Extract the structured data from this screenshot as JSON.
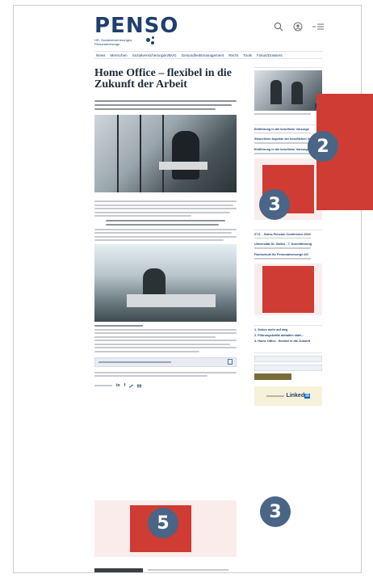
{
  "site": {
    "logo": "PENSO",
    "logo_sub": "HR, Sozialversicherungen, Personalvorsorge"
  },
  "header": {
    "icons": [
      "search-icon",
      "user-icon",
      "menu-icon"
    ]
  },
  "nav": {
    "items": [
      "News",
      "Menschen",
      "Sozialversicherungen/BVG",
      "Gesundheitsmanagement",
      "Recht",
      "Tools",
      "Fokus/Dossiers"
    ]
  },
  "article": {
    "title": "Home Office – flexibel in die Zukunft der Arbeit",
    "share_icons": [
      "linkedin-icon",
      "facebook-icon",
      "twitter-icon",
      "mail-icon"
    ]
  },
  "sidebar": {
    "events": [
      "Einführung in die berufliche Vorsorge",
      "Steuerliche Aspekte der beruflichen Vorsorge",
      "Einführung in die berufliche Vorsorge"
    ],
    "more_events": [
      "07.6. - Swiss Pension Conference 2022",
      "Universität St. Gallen - 7. Durchführung",
      "Fachschule für Personalvorsorge AG"
    ],
    "popular": [
      "1. Schon mehr auf weg",
      "2. Führungskräfte abhalten statt...",
      "3. Home Office - flexibel in die Zukunft"
    ]
  },
  "callouts": {
    "right_ad": "2",
    "side_ad": "3",
    "footer_linkedin": "3",
    "bottom_ad": "5"
  },
  "colors": {
    "brand": "#1f3f6e",
    "ad_red": "#cf3c33",
    "badge": "#4a6585"
  }
}
